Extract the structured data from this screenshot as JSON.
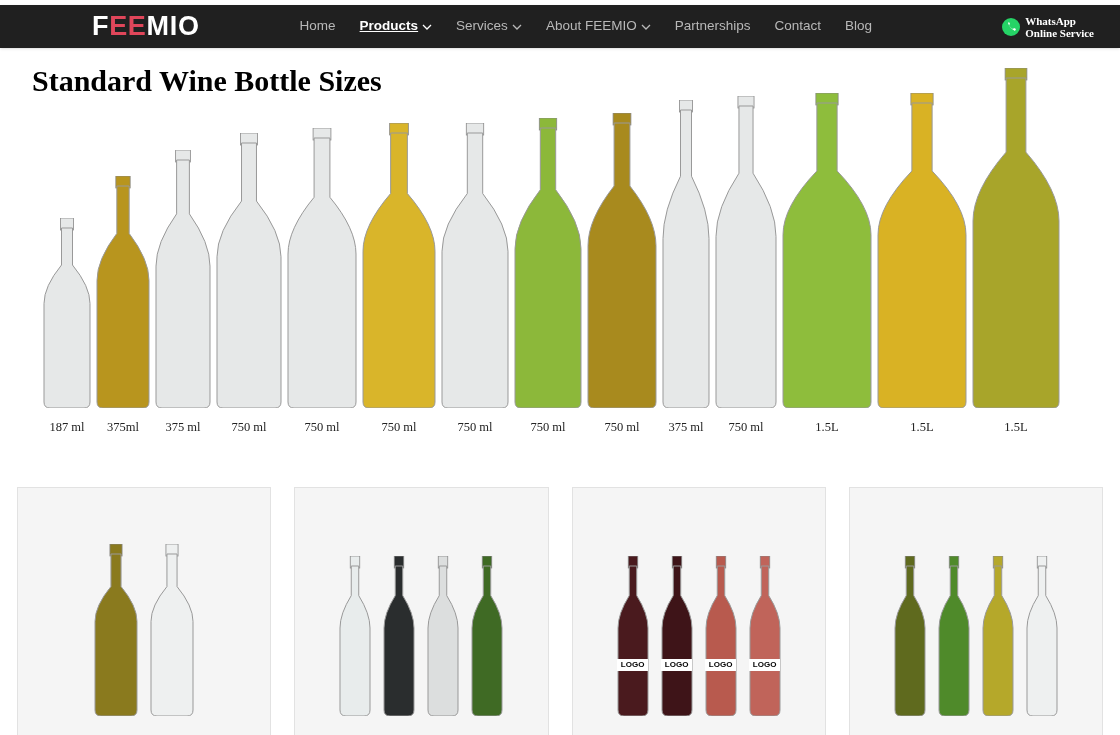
{
  "header": {
    "logo": [
      {
        "text": "F",
        "accent": false
      },
      {
        "text": "EE",
        "accent": true
      },
      {
        "text": "MIO",
        "accent": false
      }
    ],
    "nav": [
      {
        "label": "Home",
        "selected": false,
        "dropdown": false
      },
      {
        "label": "Products",
        "selected": true,
        "dropdown": true
      },
      {
        "label": "Services",
        "selected": false,
        "dropdown": true
      },
      {
        "label": "About FEEMIO",
        "selected": false,
        "dropdown": true
      },
      {
        "label": "Partnerships",
        "selected": false,
        "dropdown": false
      },
      {
        "label": "Contact",
        "selected": false,
        "dropdown": false
      },
      {
        "label": "Blog",
        "selected": false,
        "dropdown": false
      }
    ],
    "whatsapp": [
      "WhatsApp",
      "Online Service"
    ]
  },
  "sizes_chart": {
    "title": "Standard Wine Bottle Sizes",
    "bottles": [
      {
        "label": "187 ml",
        "color": "#e6e8e8"
      },
      {
        "label": "375ml",
        "color": "#b8951e"
      },
      {
        "label": "375 ml",
        "color": "#e6e8e8"
      },
      {
        "label": "750 ml",
        "color": "#e6e8e8"
      },
      {
        "label": "750 ml",
        "color": "#e6e8e8"
      },
      {
        "label": "750 ml",
        "color": "#d9b52a"
      },
      {
        "label": "750 ml",
        "color": "#e6e8e8"
      },
      {
        "label": "750 ml",
        "color": "#8cb83a"
      },
      {
        "label": "750 ml",
        "color": "#a88a1e"
      },
      {
        "label": "375 ml",
        "color": "#e6e8e8"
      },
      {
        "label": "750 ml",
        "color": "#e6e8e8"
      },
      {
        "label": "1.5L",
        "color": "#8ebd3c"
      },
      {
        "label": "1.5L",
        "color": "#d9b224"
      },
      {
        "label": "1.5L",
        "color": "#a8a52a"
      }
    ]
  },
  "products": [
    {
      "bottles": [
        {
          "color": "#8a7a1e"
        },
        {
          "color": "#eef0f0"
        }
      ]
    },
    {
      "bottles": [
        {
          "color": "#e8ecec"
        },
        {
          "color": "#2a2d2e"
        },
        {
          "color": "#dcdede"
        },
        {
          "color": "#3f6a24"
        }
      ]
    },
    {
      "bottles": [
        {
          "color": "#4a1a1e",
          "label": "LOGO"
        },
        {
          "color": "#3e1418",
          "label": "LOGO"
        },
        {
          "color": "#b85a4e",
          "label": "LOGO"
        },
        {
          "color": "#c0645a",
          "label": "LOGO"
        }
      ]
    },
    {
      "bottles": [
        {
          "color": "#5f6a1e"
        },
        {
          "color": "#4f8a2a"
        },
        {
          "color": "#b5a82a"
        },
        {
          "color": "#eef0f0"
        }
      ]
    }
  ]
}
